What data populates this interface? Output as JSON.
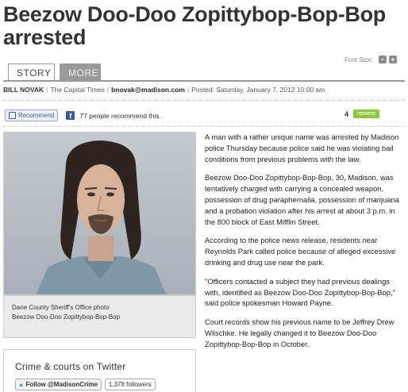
{
  "headline": "Beezow Doo-Doo Zopittybop-Bop-Bop arrested",
  "tabs": {
    "story": "STORY",
    "more": "MORE"
  },
  "font_size": {
    "label": "Font Size:",
    "decrease": "−",
    "increase": "+"
  },
  "byline": {
    "author": "BILL NOVAK",
    "publication": "The Capital Times",
    "email": "bnovak@madison.com",
    "posted": "Posted: Saturday, January 7, 2012 10:00 am"
  },
  "social": {
    "recommend_label": "Recommend",
    "recommend_count_text": "77 people recommend this.",
    "retweet_count": "4",
    "retweet_label": "retweet"
  },
  "photo": {
    "caption_line1": "Dane County Sheriff's Office photo",
    "caption_line2": "Beezow Doo-Doo Zopittybop-Bop-Bop"
  },
  "twitter_box": {
    "title": "Crime & courts on Twitter",
    "follow_label": "Follow @MadisonCrime",
    "followers": "1,378 followers"
  },
  "article": {
    "paragraphs": [
      "A man with a rather unique name was arrested by Madison police Thursday because police said he was violating bail conditions from previous problems with the law.",
      "Beezow Doo-Doo Zopittybop-Bop-Bop, 30, Madison, was tentatively charged with carrying a concealed weapon, possession of drug paraphernalia, possession of marijuana and a probation violation after his arrest at about 3 p.m. in the 800 block of East Mifflin Street.",
      "According to the police news release, residents near Reynolds Park called police because of alleged excessive drinking and drug use near the park.",
      "\"Officers contacted a subject they had previous dealings with, identified as Beezow Doo-Doo Zopittybop-Bop-Bop,\" said police spokesman Howard Payne.",
      "Court records show his previous name to be Jeffrey Drew Wilschke. He legally changed it to Beezow Doo-Doo Zopittybop-Bop-Bop in October."
    ]
  },
  "colors": {
    "tab_border": "#9a9a9a",
    "retweet_green": "#8cc63f",
    "facebook_blue": "#3b5998",
    "twitter_blue": "#2fa5e0"
  }
}
